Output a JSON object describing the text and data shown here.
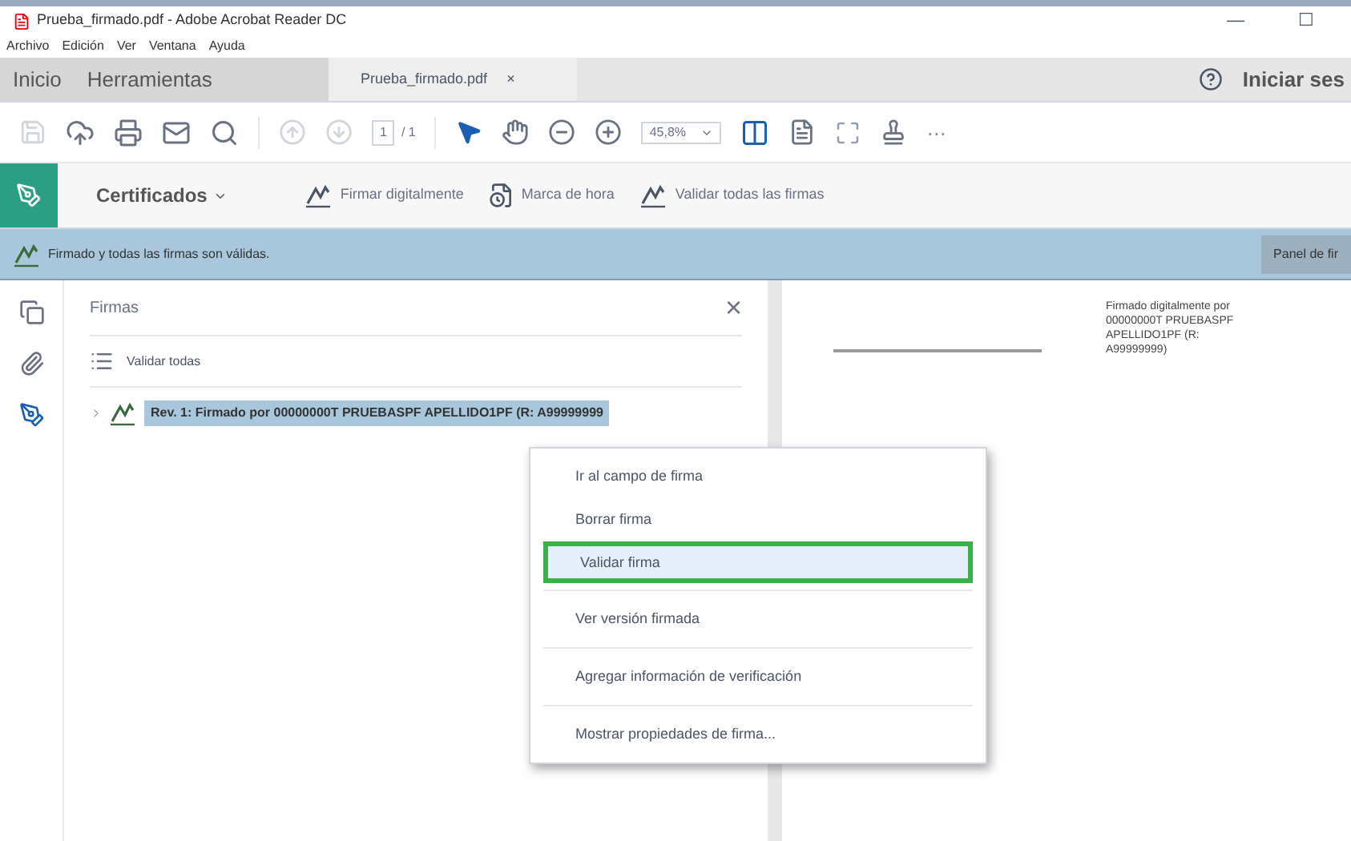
{
  "window": {
    "title": "Prueba_firmado.pdf - Adobe Acrobat Reader DC",
    "controls": [
      "—",
      "☐"
    ]
  },
  "menu_bar": [
    "Archivo",
    "Edición",
    "Ver",
    "Ventana",
    "Ayuda"
  ],
  "nav_tabs": [
    {
      "label": "Inicio",
      "selected": false
    },
    {
      "label": "Herramientas",
      "selected": false
    }
  ],
  "document_tab": {
    "label": "Prueba_firmado.pdf",
    "close": "×"
  },
  "account": {
    "label": "Iniciar ses"
  },
  "toolbar": {
    "page": "1",
    "page_total": "/ 1",
    "zoom": "45,8%",
    "more": "···"
  },
  "certificates_bar": {
    "menu": "Certificados",
    "items": [
      {
        "kind": "sign",
        "label": "Firmar digitalmente"
      },
      {
        "kind": "stamp",
        "label": "Marca de hora"
      },
      {
        "kind": "validate",
        "label": "Validar todas las firmas"
      }
    ]
  },
  "banner": {
    "message": "Firmado y todas las firmas son válidas.",
    "button": "Panel de fir"
  },
  "signatures_panel": {
    "title": "Firmas",
    "close": "×",
    "validate_all": "Validar todas",
    "signature": {
      "label": "Rev. 1: Firmado por 00000000T PRUEBASPF APELLIDO1PF (R: A99999999",
      "selected": true
    }
  },
  "document": {
    "stamp": "Firmado digitalmente por 00000000T PRUEBASPF APELLIDO1PF (R: A99999999)"
  },
  "context_menu": [
    {
      "label": "Ir al campo de firma",
      "selected": false
    },
    {
      "label": "Borrar firma",
      "selected": false
    },
    {
      "label": "Validar firma",
      "selected": true
    },
    {
      "label": "Ver versión firmada",
      "selected": false
    },
    {
      "label": "Agregar información de verificación",
      "selected": false
    },
    {
      "label": "Mostrar propiedades de firma...",
      "selected": false
    }
  ]
}
